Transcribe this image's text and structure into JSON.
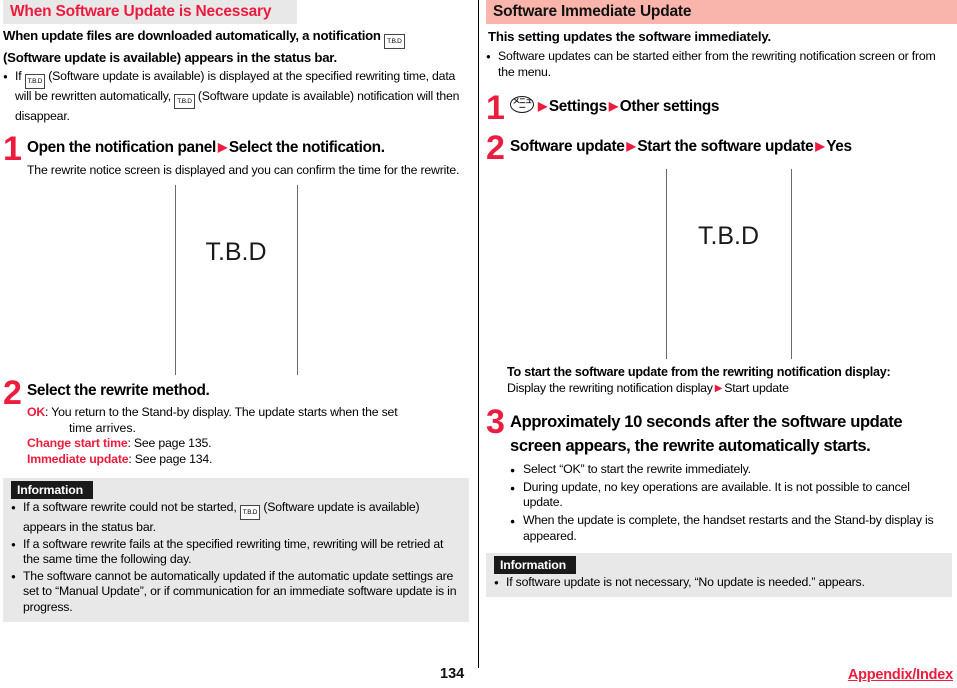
{
  "footer": {
    "page_number": "134",
    "link_label": "Appendix/Index"
  },
  "icons": {
    "tbd_small": "T.B.D",
    "tbd_large": "T.B.D",
    "menu_key_label": "メニュー",
    "arrow": "▶"
  },
  "left_column": {
    "heading": "When Software Update is Necessary",
    "lead": "When update files are downloaded automatically, a notification",
    "lead_tail": "(Software update is available) appears in the status bar.",
    "bullet_1_part1": "If",
    "bullet_1_part2": "(Software update is available) is displayed at the specified rewriting time, data will be rewritten automatically,",
    "bullet_1_part3": "(Software update is available) notification will then disappear.",
    "step1": {
      "number": "1",
      "title_part1": "Open the notification panel",
      "title_part2": "Select the notification.",
      "body": "The rewrite notice screen is displayed and you can confirm the time for the rewrite."
    },
    "step2": {
      "number": "2",
      "title": "Select the rewrite method.",
      "options": [
        {
          "term": "OK",
          "sep": ": ",
          "desc": "You return to the Stand-by display. The update starts when the set",
          "cont": "time arrives."
        },
        {
          "term": "Change start time",
          "sep": ": ",
          "desc": "See page 135.",
          "cont": ""
        },
        {
          "term": "Immediate update",
          "sep": ": ",
          "desc": "See page 134.",
          "cont": ""
        }
      ]
    },
    "information": {
      "label": "Information",
      "items": [
        {
          "part1": "If a software rewrite could not be started,",
          "part2": "(Software update is available) appears in the status bar.",
          "has_icon": true
        },
        {
          "part1": "If a software rewrite fails at the specified rewriting time, rewriting will be retried at the same time the following day.",
          "part2": "",
          "has_icon": false
        },
        {
          "part1": "The software cannot be automatically updated if the automatic update settings are set to “Manual Update”, or if communication for an immediate software update is in progress.",
          "part2": "",
          "has_icon": false
        }
      ]
    }
  },
  "right_column": {
    "heading": "Software Immediate Update",
    "lead": "This setting updates the software immediately.",
    "bullet_1": "Software updates can be started either from the rewriting notification screen or from the menu.",
    "step1": {
      "number": "1",
      "item1": "Settings",
      "item2": "Other settings"
    },
    "step2": {
      "number": "2",
      "item1": "Software update",
      "item2": "Start the software update",
      "item3": "Yes"
    },
    "note": {
      "heading": "To start the software update from the rewriting notification display:",
      "part1": "Display the rewriting notification display",
      "part2": "Start update"
    },
    "step3": {
      "number": "3",
      "title_line1": "Approximately 10 seconds after the software update",
      "title_line2": "screen appears, the rewrite automatically starts.",
      "bullets": [
        "Select “OK” to start the rewrite immediately.",
        "During update, no key operations are available. It is not possible to cancel update.",
        "When the update is complete, the handset restarts and the Stand-by display is appeared."
      ]
    },
    "information": {
      "label": "Information",
      "items": [
        "If software update is not necessary, “No update is needed.” appears."
      ]
    }
  }
}
